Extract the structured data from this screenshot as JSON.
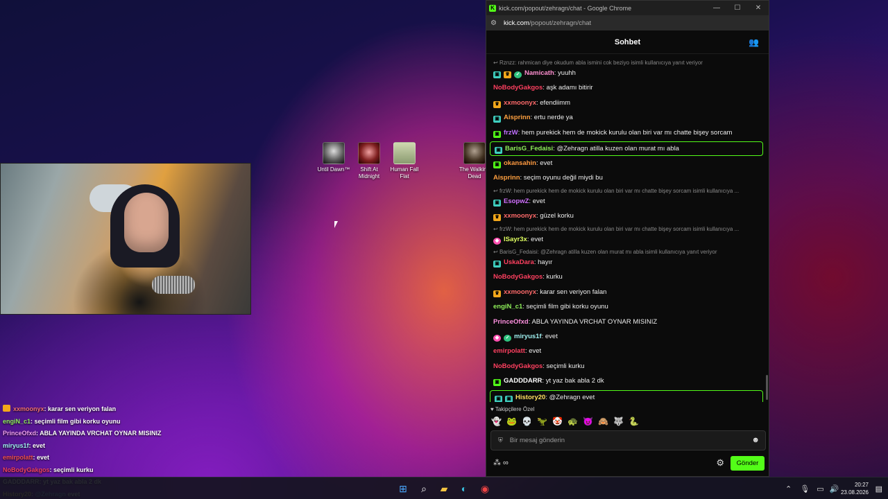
{
  "desktop_icons": [
    {
      "label": "Until Dawn™"
    },
    {
      "label": "Shift At Midnight"
    },
    {
      "label": "Human Fall Flat"
    },
    {
      "label": "The Walking Dead"
    }
  ],
  "overlay_chat": [
    {
      "user": "xxmoonyx",
      "text": ": karar sen veriyon falan",
      "color": "#f07070",
      "badge": "crown"
    },
    {
      "user": "engiN_c1",
      "text": ": seçimli film gibi korku oyunu",
      "color": "#8ff05a"
    },
    {
      "user": "PrinceOfxd",
      "text": ": ABLA YAYINDA VRCHAT OYNAR MISINIZ",
      "color": "#f0a0f0"
    },
    {
      "user": "miryus1f",
      "text": ": evet",
      "color": "#9ff0f0"
    },
    {
      "user": "emirpolatt",
      "text": ": evet",
      "color": "#f05050"
    },
    {
      "user": "NoBodyGakgos",
      "text": ": seçimli kurku",
      "color": "#f04060"
    },
    {
      "user": "GADDDARR",
      "text": ": yt yaz bak abla 2 dk",
      "color": "#ffffff"
    },
    {
      "user": "History20",
      "text": ": ",
      "mention": "@Zehragn",
      "text2": " evet",
      "color": "#ffe080"
    }
  ],
  "window": {
    "title": "kick.com/popout/zehragn/chat - Google Chrome",
    "url_host": "kick.com",
    "url_path": "/popout/zehragn/chat",
    "chat_title": "Sohbet"
  },
  "messages": [
    {
      "type": "reply",
      "text": "Rznzz: rahmican diye okudum abla ismini cok beziyo isimli kullanıcıya yanıt veriyor"
    },
    {
      "type": "msg",
      "badges": [
        "sub",
        "crown",
        "verif"
      ],
      "user": "Namicath",
      "color": "#ff8fd0",
      "text": ": yuuhh"
    },
    {
      "type": "msg",
      "badges": [],
      "user": "NoBodyGakgos",
      "color": "#ff4060",
      "text": ": aşk adamı bitirir"
    },
    {
      "type": "msg",
      "badges": [
        "crown"
      ],
      "user": "xxmoonyx",
      "color": "#ff6a6a",
      "text": ": efendiimm"
    },
    {
      "type": "msg",
      "badges": [
        "sub"
      ],
      "user": "Aisprinn",
      "color": "#ffa040",
      "text": ": ertu nerde ya"
    },
    {
      "type": "msg",
      "badges": [
        "gift"
      ],
      "user": "frzW",
      "color": "#c070ff",
      "text": ": hem purekick hem de mokick kurulu olan biri var mı chatte bişey sorcam"
    },
    {
      "type": "highlight",
      "badges": [
        "sub"
      ],
      "user": "BarisG_Fedaisi",
      "color": "#8ff05a",
      "text": ": @Zehragn atilla kuzen olan murat mı abla"
    },
    {
      "type": "msg",
      "badges": [
        "gift"
      ],
      "user": "okansahin",
      "color": "#ff9a40",
      "text": ": evet"
    },
    {
      "type": "msg",
      "badges": [],
      "user": "Aisprinn",
      "color": "#ffa040",
      "text": ": seçim oyunu değil miydi bu"
    },
    {
      "type": "reply",
      "text": "frzW: hem purekick hem de mokick kurulu olan biri var mı chatte bişey sorcam isimli kullanıcıya ..."
    },
    {
      "type": "msg",
      "badges": [
        "sub"
      ],
      "user": "EsopwZ",
      "color": "#d070ff",
      "text": ": evet"
    },
    {
      "type": "msg",
      "badges": [
        "crown"
      ],
      "user": "xxmoonyx",
      "color": "#ff6a6a",
      "text": ": güzel korku"
    },
    {
      "type": "reply",
      "text": "frzW: hem purekick hem de mokick kurulu olan biri var mı chatte bişey sorcam isimli kullanıcıya ..."
    },
    {
      "type": "msg",
      "badges": [
        "og"
      ],
      "user": "ISayr3x",
      "color": "#e0ff60",
      "text": ": evet"
    },
    {
      "type": "reply",
      "text": "BarisG_Fedaisi: @Zehragn atilla kuzen olan murat mı abla isimli kullanıcıya yanıt veriyor"
    },
    {
      "type": "msg",
      "badges": [
        "sub"
      ],
      "user": "UskaDara",
      "color": "#ff4060",
      "text": ": hayır"
    },
    {
      "type": "msg",
      "badges": [],
      "user": "NoBodyGakgos",
      "color": "#ff4060",
      "text": ": kurku"
    },
    {
      "type": "msg",
      "badges": [
        "crown"
      ],
      "user": "xxmoonyx",
      "color": "#ff6a6a",
      "text": ": karar sen veriyon falan"
    },
    {
      "type": "msg",
      "badges": [],
      "user": "engiN_c1",
      "color": "#8ff05a",
      "text": ": seçimli film gibi korku oyunu"
    },
    {
      "type": "msg",
      "badges": [],
      "user": "PrinceOfxd",
      "color": "#ff90e0",
      "text": ": ABLA YAYINDA VRCHAT OYNAR MISINIZ"
    },
    {
      "type": "msg",
      "badges": [
        "og",
        "verif"
      ],
      "user": "miryus1f",
      "color": "#9ff0f0",
      "text": ": evet"
    },
    {
      "type": "msg",
      "badges": [],
      "user": "emirpolatt",
      "color": "#ff4060",
      "text": ": evet"
    },
    {
      "type": "msg",
      "badges": [],
      "user": "NoBodyGakgos",
      "color": "#ff4060",
      "text": ": seçimli kurku"
    },
    {
      "type": "msg",
      "badges": [
        "gift"
      ],
      "user": "GADDDARR",
      "color": "#ffffff",
      "text": ": yt yaz bak abla 2 dk"
    },
    {
      "type": "highlight",
      "badges": [
        "sub",
        "sub"
      ],
      "user": "History20",
      "color": "#ffe060",
      "text": ": @Zehragn evet"
    }
  ],
  "emotes_label": "Takipçilere Özel",
  "emotes": [
    "👻",
    "🐸",
    "💀",
    "🦖",
    "🤡",
    "🐢",
    "😈",
    "🙈",
    "🐺",
    "🐍"
  ],
  "input": {
    "placeholder": "Bir mesaj gönderin"
  },
  "send_label": "Gönder",
  "clock": {
    "time": "20:27",
    "date": "23.08.2026"
  },
  "colors": {
    "kick_green": "#53fc18"
  }
}
